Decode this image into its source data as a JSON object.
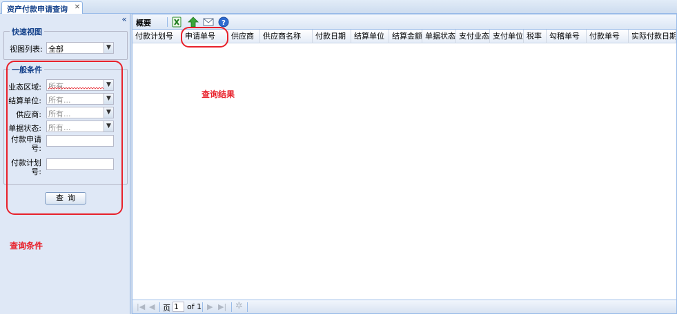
{
  "tab": {
    "title": "资产付款申请查询",
    "close_glyph": "✕"
  },
  "left_panel": {
    "collapse_glyph": "«",
    "quick_view": {
      "legend": "快速视图",
      "view_list_label": "视图列表:",
      "view_list_value": "全部"
    },
    "general": {
      "legend": "一般条件",
      "fields": [
        {
          "label": "业态区域:",
          "placeholder": "所有..."
        },
        {
          "label": "结算单位:",
          "placeholder": "所有..."
        },
        {
          "label": "供应商:",
          "placeholder": "所有..."
        },
        {
          "label": "单据状态:",
          "placeholder": "所有..."
        }
      ],
      "payment_request_no_label": "付款申请号:",
      "payment_plan_no_label": "付款计划号:"
    },
    "query_button": "查询",
    "annotation": "查询条件"
  },
  "main": {
    "toolbar_title": "概要",
    "icons": [
      "excel-export-icon",
      "upload-icon",
      "mail-icon",
      "help-icon"
    ],
    "columns": [
      "付款计划号",
      "申请单号",
      "供应商",
      "供应商名称",
      "付款日期",
      "结算单位",
      "结算金额",
      "单据状态",
      "支付业态",
      "支付单位",
      "税率",
      "勾稽单号",
      "付款单号",
      "实际付款日期"
    ],
    "annotation": "查询结果",
    "pager": {
      "page_label": "页",
      "page_value": "1",
      "of_label": "of 1"
    }
  },
  "colors": {
    "annotation_red": "#e8202a",
    "panel_bg": "#dfe8f6",
    "header_blue": "#15428b",
    "border_blue": "#99bbe8"
  }
}
